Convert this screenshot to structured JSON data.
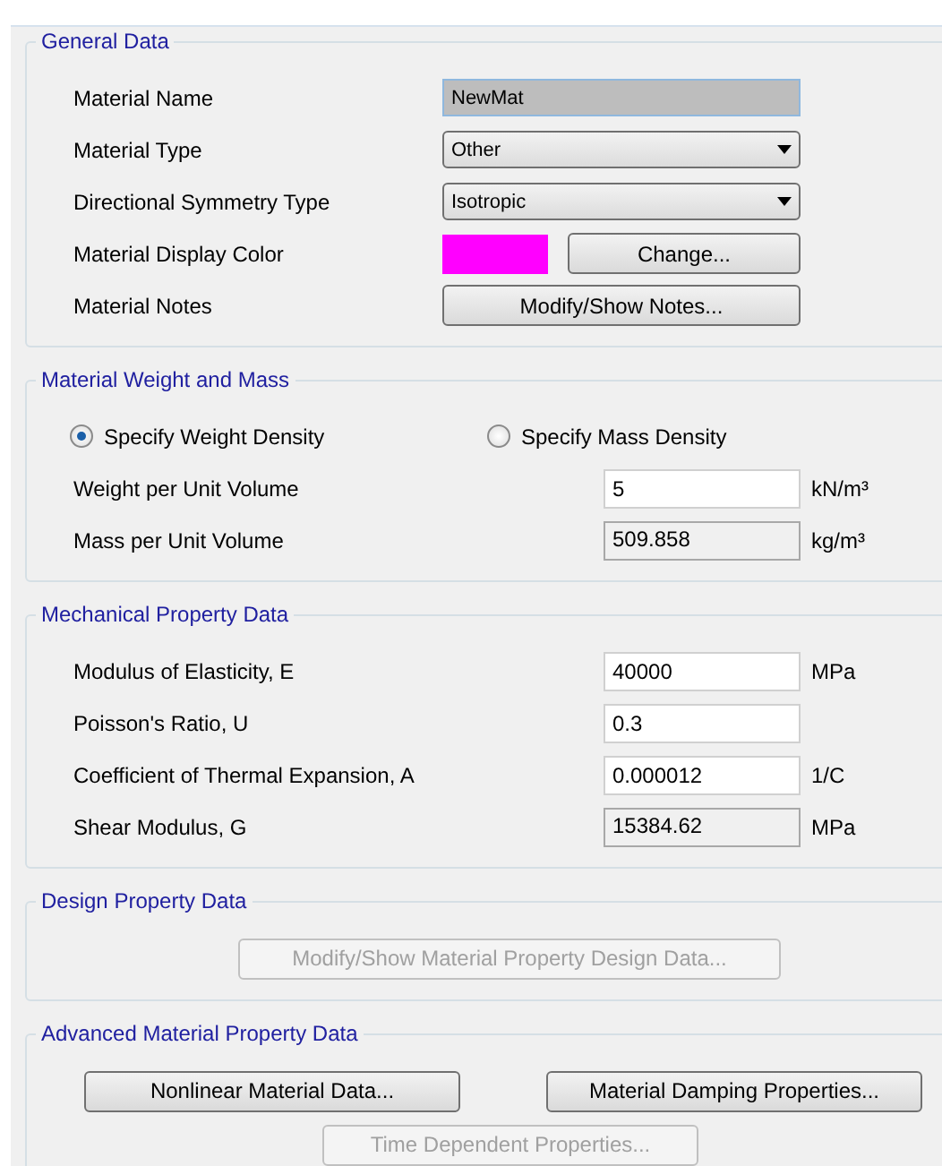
{
  "sections": [
    {
      "title": "General Data",
      "rows": [
        {
          "kind": "text",
          "label": "Material Name",
          "value": "NewMat",
          "highlighted": true
        },
        {
          "kind": "dropdown",
          "label": "Material Type",
          "value": "Other"
        },
        {
          "kind": "dropdown",
          "label": "Directional Symmetry Type",
          "value": "Isotropic"
        },
        {
          "kind": "color",
          "label": "Material Display Color",
          "color": "#ff00ff",
          "button": "Change..."
        },
        {
          "kind": "button",
          "label": "Material Notes",
          "button": "Modify/Show Notes..."
        }
      ]
    },
    {
      "title": "Material Weight and Mass",
      "rows": [
        {
          "kind": "radios",
          "options": [
            {
              "label": "Specify Weight Density",
              "selected": true
            },
            {
              "label": "Specify Mass Density",
              "selected": false
            }
          ]
        },
        {
          "kind": "number",
          "label": "Weight per Unit Volume",
          "value": "5",
          "unit": "kN/m³",
          "readonly": false
        },
        {
          "kind": "number",
          "label": "Mass per Unit Volume",
          "value": "509.858",
          "unit": "kg/m³",
          "readonly": true
        }
      ]
    },
    {
      "title": "Mechanical Property Data",
      "rows": [
        {
          "kind": "number",
          "label": "Modulus of Elasticity,  E",
          "value": "40000",
          "unit": "MPa",
          "readonly": false
        },
        {
          "kind": "number",
          "label": "Poisson's Ratio,  U",
          "value": "0.3",
          "readonly": false
        },
        {
          "kind": "number",
          "label": "Coefficient of Thermal Expansion,  A",
          "value": "0.000012",
          "unit": "1/C",
          "readonly": false
        },
        {
          "kind": "number",
          "label": "Shear Modulus,  G",
          "value": "15384.62",
          "unit": "MPa",
          "readonly": true
        }
      ]
    },
    {
      "title": "Design Property Data",
      "rows": [
        {
          "kind": "buttons",
          "buttons": [
            {
              "label": "Modify/Show Material Property Design Data...",
              "disabled": true
            }
          ]
        }
      ]
    },
    {
      "title": "Advanced Material Property Data",
      "rows": [
        {
          "kind": "buttons",
          "buttons": [
            {
              "label": "Nonlinear Material Data...",
              "disabled": false
            },
            {
              "label": "Material Damping Properties...",
              "disabled": false
            }
          ]
        },
        {
          "kind": "buttons",
          "buttons": [
            {
              "label": "Time Dependent Properties...",
              "disabled": true
            }
          ]
        }
      ]
    }
  ]
}
